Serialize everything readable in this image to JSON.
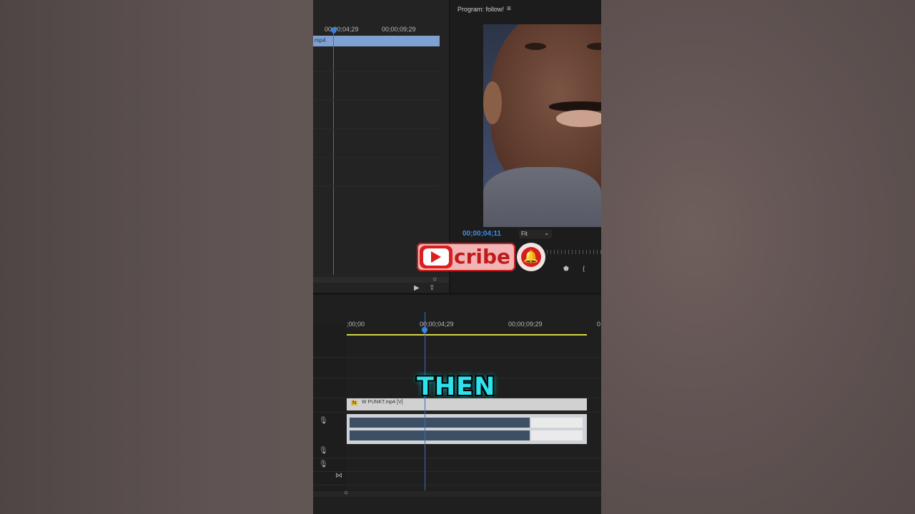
{
  "source_monitor": {
    "ruler": [
      "00;00;04;29",
      "00;00;09;29"
    ],
    "clip_label": "mp4"
  },
  "program_monitor": {
    "title": "Program: follow!",
    "menu_icon": "hamburger-icon",
    "timecode": "00;00;04;11",
    "fit_label": "Fit",
    "fit_arrow": "⌄"
  },
  "timeline": {
    "ruler": [
      ";00;00",
      "00;00;04;29",
      "00;00;09;29",
      "0"
    ],
    "video_clip_label": "W PUNKT.mp4 [V]",
    "fx_badge": "fx"
  },
  "overlay": {
    "subscribe_text": "cribe",
    "caption": "THEN"
  },
  "colors": {
    "accent_blue": "#3f8ee6",
    "subscribe_red": "#c01b1b",
    "caption_cyan": "#2ee3ee"
  }
}
